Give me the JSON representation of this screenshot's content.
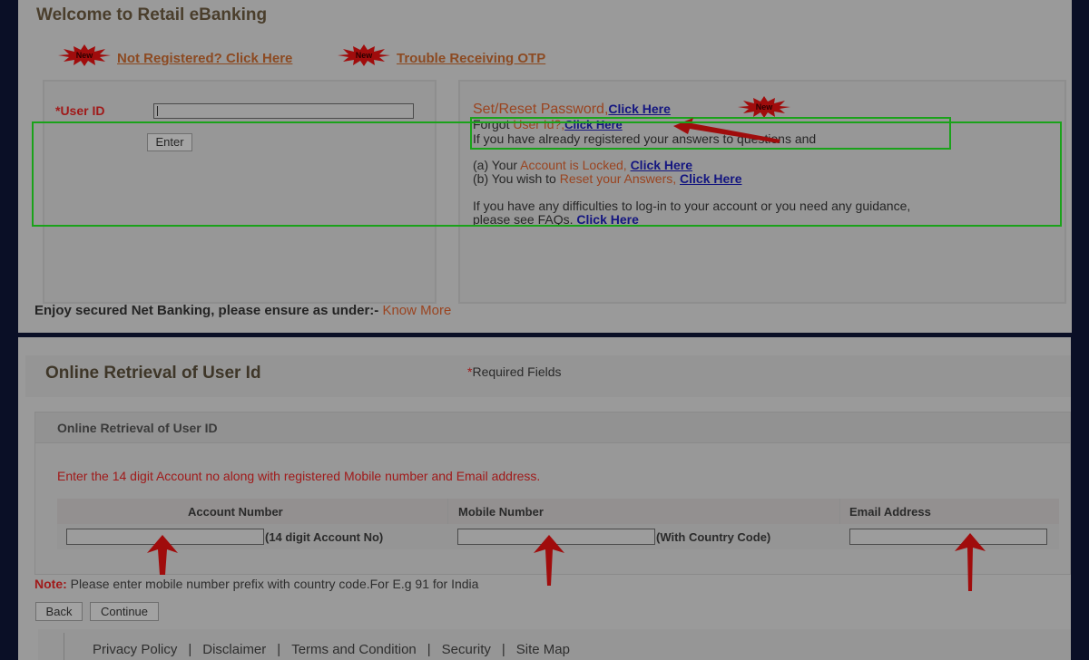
{
  "top": {
    "title": "Welcome to Retail eBanking",
    "new_badge_text": "New",
    "not_registered_link": "Not Registered? Click Here",
    "trouble_otp_link": "Trouble Receiving OTP",
    "login": {
      "user_id_label": "*User ID",
      "user_id_value": "",
      "enter_button": "Enter"
    },
    "help": {
      "set_reset_label": "Set/Reset Password",
      "set_reset_comma": ",",
      "set_reset_link": "Click Here",
      "forgot_prefix": "Forgot ",
      "forgot_highlight": "User Id?",
      "forgot_comma": ",",
      "forgot_link": "Click Here",
      "registered_text": "If you have already registered your answers to questions and",
      "locked_prefix": "(a) Your ",
      "locked_highlight": "Account is Locked",
      "locked_comma": ", ",
      "locked_link": "Click Here",
      "reset_prefix": "(b) You wish to ",
      "reset_highlight": "Reset your Answers",
      "reset_comma": ", ",
      "reset_link": "Click Here",
      "difficulty_text": "If you have any difficulties to log-in to your account or you need any guidance,",
      "faq_text": "please see FAQs. ",
      "faq_link": "Click Here"
    },
    "enjoy_text": "Enjoy secured Net Banking, please ensure as under:- ",
    "know_more_link": "Know More"
  },
  "bottom": {
    "title": "Online Retrieval of User Id",
    "required_star": "*",
    "required_text": "Required Fields",
    "section_title": "Online Retrieval of User ID",
    "instruction": "Enter the 14 digit Account no along with registered Mobile number and Email address.",
    "columns": [
      "Account Number",
      "Mobile Number",
      "Email Address"
    ],
    "fields": {
      "account_number": {
        "value": "",
        "hint": "(14 digit Account No)"
      },
      "mobile_number": {
        "value": "",
        "hint": "(With Country Code)"
      },
      "email_address": {
        "value": ""
      }
    },
    "note_label": "Note:",
    "note_text": " Please enter mobile number prefix with country code.For E.g 91 for India",
    "back_button": "Back",
    "continue_button": "Continue",
    "footer_links": [
      "Privacy Policy",
      "Disclaimer",
      "Terms and Condition",
      "Security",
      "Site Map"
    ],
    "footer_separator": "|"
  },
  "colors": {
    "highlight_box": "#1aa21a",
    "annotation_arrow": "#a00c0c",
    "link_blue": "#141680",
    "accent_orange": "#9a4420",
    "required_red": "#a01a1a"
  }
}
